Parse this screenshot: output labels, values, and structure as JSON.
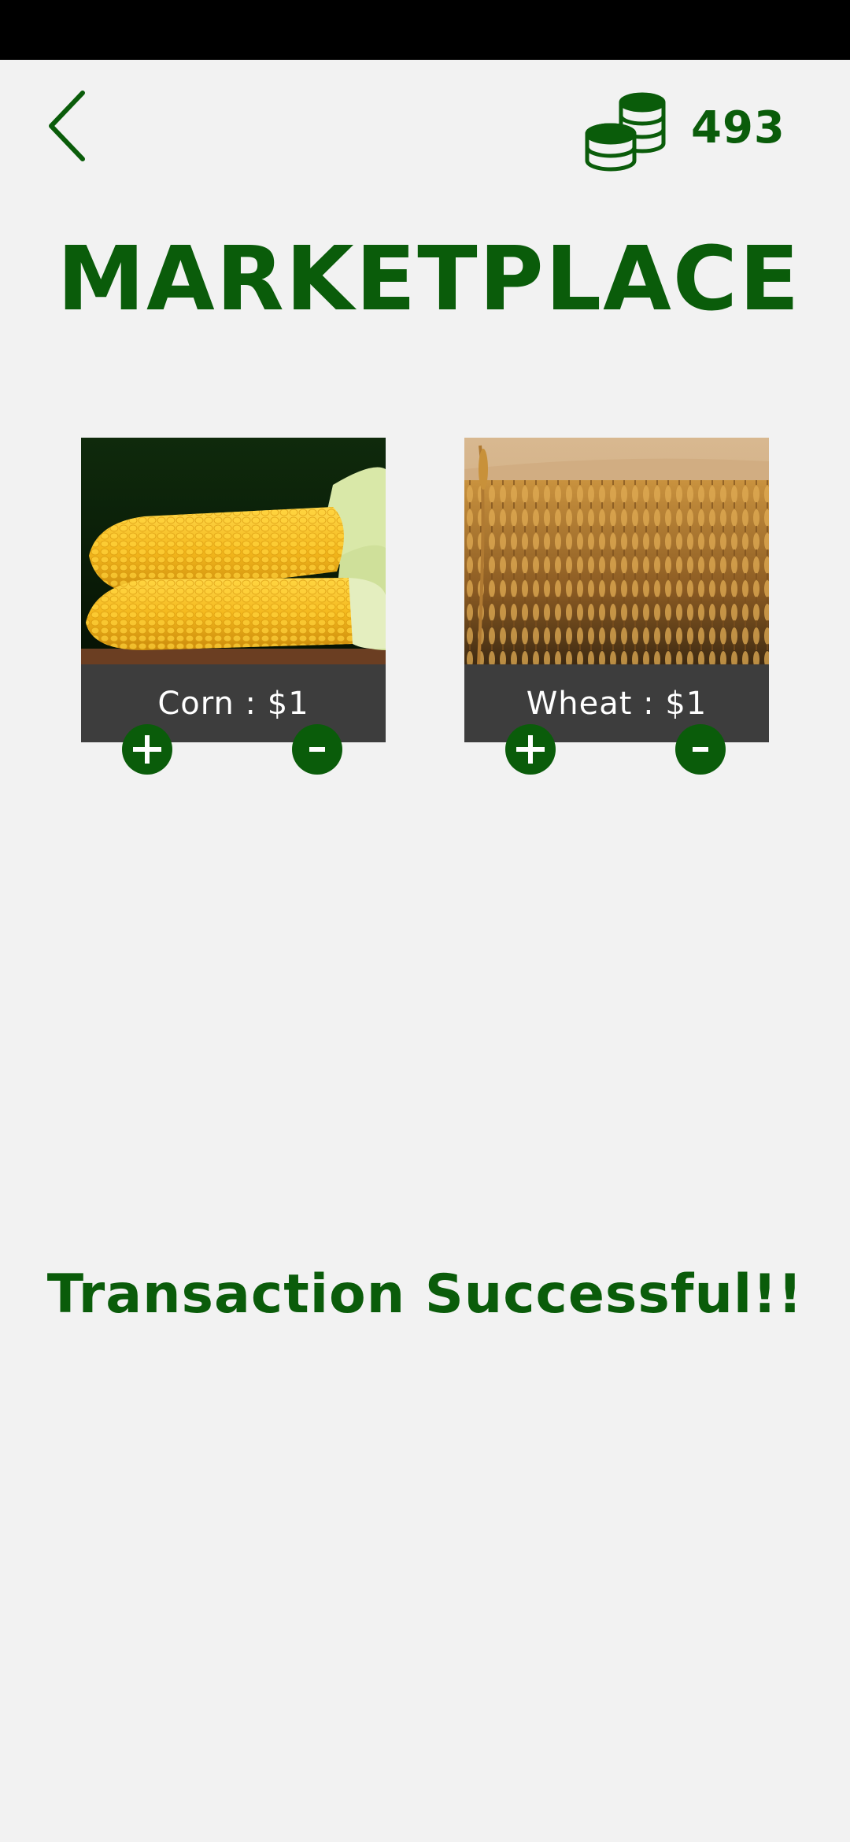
{
  "header": {
    "back_icon": "chevron-left-icon",
    "coin_icon": "coins-stack-icon",
    "coin_balance": "493"
  },
  "title": "MARKETPLACE",
  "products": [
    {
      "name": "Corn",
      "price": "$1",
      "label": "Corn : $1",
      "image": "corn-cobs-photo",
      "add_icon": "plus-icon",
      "remove_icon": "minus-icon"
    },
    {
      "name": "Wheat",
      "price": "$1",
      "label": "Wheat : $1",
      "image": "wheat-field-photo",
      "add_icon": "plus-icon",
      "remove_icon": "minus-icon"
    }
  ],
  "status_message": "Transaction Successful!!",
  "colors": {
    "brand_green": "#0a5c0a",
    "background": "#f2f2f2",
    "label_bar": "#3d3d3d",
    "status_bar": "#000000"
  }
}
